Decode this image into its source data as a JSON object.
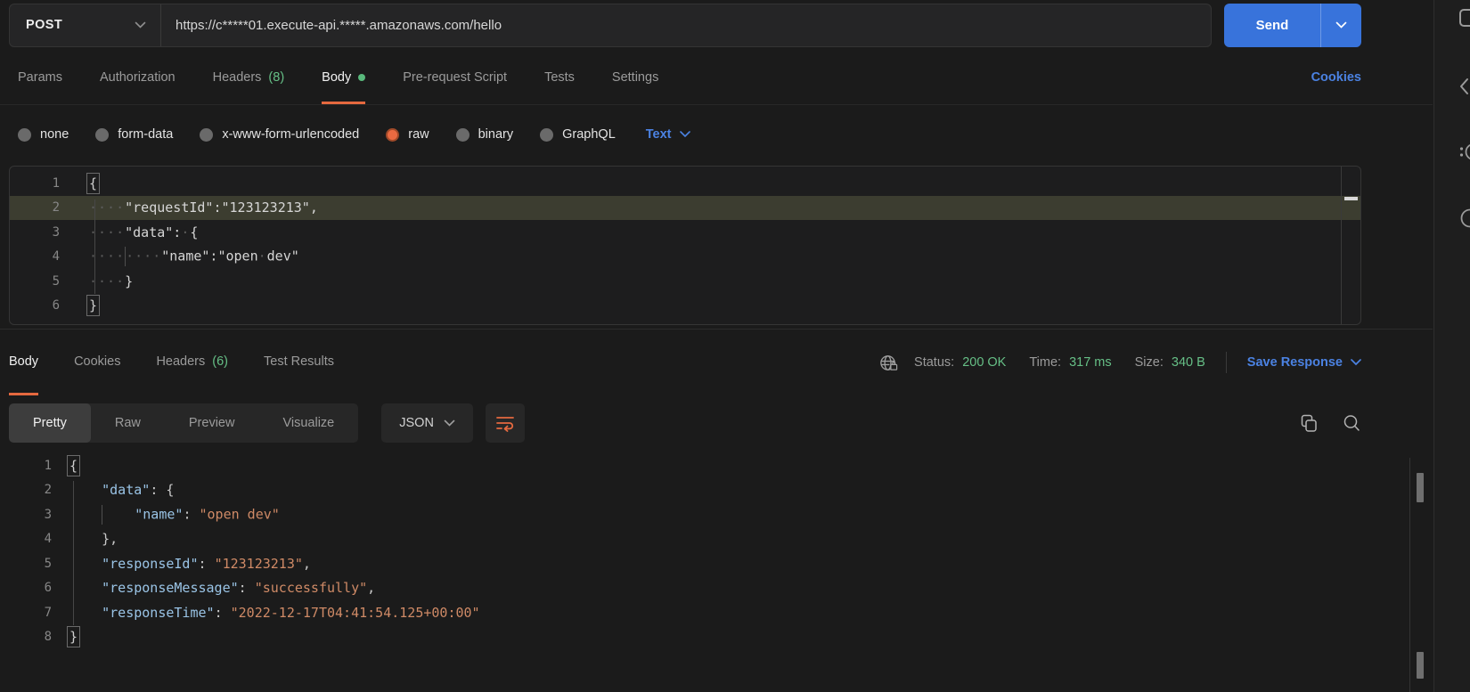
{
  "request_bar": {
    "method": "POST",
    "url": "https://c*****01.execute-api.*****.amazonaws.com/hello",
    "send_label": "Send"
  },
  "request_tabs": {
    "items": [
      {
        "label": "Params"
      },
      {
        "label": "Authorization"
      },
      {
        "label": "Headers",
        "count": "(8)"
      },
      {
        "label": "Body",
        "active": true
      },
      {
        "label": "Pre-request Script"
      },
      {
        "label": "Tests"
      },
      {
        "label": "Settings"
      }
    ],
    "cookies_link": "Cookies"
  },
  "body_type_bar": {
    "options": [
      {
        "label": "none"
      },
      {
        "label": "form-data"
      },
      {
        "label": "x-www-form-urlencoded"
      },
      {
        "label": "raw",
        "selected": true
      },
      {
        "label": "binary"
      },
      {
        "label": "GraphQL"
      }
    ],
    "format_selector": "Text"
  },
  "request_editor": {
    "lines": [
      {
        "n": 1,
        "tokens": [
          {
            "t": "{",
            "c": "plain fold"
          }
        ]
      },
      {
        "n": 2,
        "hl": true,
        "tokens": [
          {
            "w": 4
          },
          {
            "t": "\"requestId\":\"123123213\",",
            "c": "plain"
          }
        ]
      },
      {
        "n": 3,
        "tokens": [
          {
            "w": 4
          },
          {
            "t": "\"data\":",
            "c": "plain"
          },
          {
            "w": 1
          },
          {
            "t": "{",
            "c": "plain"
          }
        ]
      },
      {
        "n": 4,
        "tokens": [
          {
            "w": 4
          },
          {
            "g": 1
          },
          {
            "w": 4
          },
          {
            "t": "\"name\":\"open",
            "c": "plain"
          },
          {
            "w": 1
          },
          {
            "t": "dev\"",
            "c": "plain"
          }
        ]
      },
      {
        "n": 5,
        "tokens": [
          {
            "w": 4
          },
          {
            "t": "}",
            "c": "plain"
          }
        ]
      },
      {
        "n": 6,
        "tokens": [
          {
            "t": "}",
            "c": "plain fold"
          }
        ]
      }
    ]
  },
  "response_meta": {
    "tabs": [
      {
        "label": "Body",
        "active": true
      },
      {
        "label": "Cookies"
      },
      {
        "label": "Headers",
        "count": "(6)"
      },
      {
        "label": "Test Results"
      }
    ],
    "status_label": "Status:",
    "status_value": "200 OK",
    "time_label": "Time:",
    "time_value": "317 ms",
    "size_label": "Size:",
    "size_value": "340 B",
    "save_response_label": "Save Response"
  },
  "response_toolbar": {
    "views": [
      {
        "label": "Pretty",
        "active": true
      },
      {
        "label": "Raw"
      },
      {
        "label": "Preview"
      },
      {
        "label": "Visualize"
      }
    ],
    "format_selector": "JSON"
  },
  "response_editor": {
    "lines": [
      {
        "n": 1,
        "tokens": [
          {
            "t": "{",
            "c": "punct fold"
          }
        ]
      },
      {
        "n": 2,
        "tokens": [
          {
            "t": "    ",
            "c": "sp"
          },
          {
            "t": "\"data\"",
            "c": "key"
          },
          {
            "t": ": {",
            "c": "punct"
          }
        ]
      },
      {
        "n": 3,
        "tokens": [
          {
            "t": "    ",
            "c": "sp"
          },
          {
            "g": 1
          },
          {
            "t": "    ",
            "c": "sp"
          },
          {
            "t": "\"name\"",
            "c": "key"
          },
          {
            "t": ": ",
            "c": "punct"
          },
          {
            "t": "\"open dev\"",
            "c": "str"
          }
        ]
      },
      {
        "n": 4,
        "tokens": [
          {
            "t": "    ",
            "c": "sp"
          },
          {
            "t": "},",
            "c": "punct"
          }
        ]
      },
      {
        "n": 5,
        "tokens": [
          {
            "t": "    ",
            "c": "sp"
          },
          {
            "t": "\"responseId\"",
            "c": "key"
          },
          {
            "t": ": ",
            "c": "punct"
          },
          {
            "t": "\"123123213\"",
            "c": "str"
          },
          {
            "t": ",",
            "c": "punct"
          }
        ]
      },
      {
        "n": 6,
        "tokens": [
          {
            "t": "    ",
            "c": "sp"
          },
          {
            "t": "\"responseMessage\"",
            "c": "key"
          },
          {
            "t": ": ",
            "c": "punct"
          },
          {
            "t": "\"successfully\"",
            "c": "str"
          },
          {
            "t": ",",
            "c": "punct"
          }
        ]
      },
      {
        "n": 7,
        "tokens": [
          {
            "t": "    ",
            "c": "sp"
          },
          {
            "t": "\"responseTime\"",
            "c": "key"
          },
          {
            "t": ": ",
            "c": "punct"
          },
          {
            "t": "\"2022-12-17T04:41:54.125+00:00\"",
            "c": "str"
          }
        ]
      },
      {
        "n": 8,
        "tokens": [
          {
            "t": "}",
            "c": "punct fold"
          }
        ]
      }
    ]
  },
  "colors": {
    "accent_orange": "#e5693f",
    "link_blue": "#4b82e2",
    "send_blue": "#3873db",
    "success_green": "#66bf86",
    "json_key": "#9ac4e6",
    "json_string": "#cf8a66",
    "line_highlight": "#3c3d30"
  }
}
